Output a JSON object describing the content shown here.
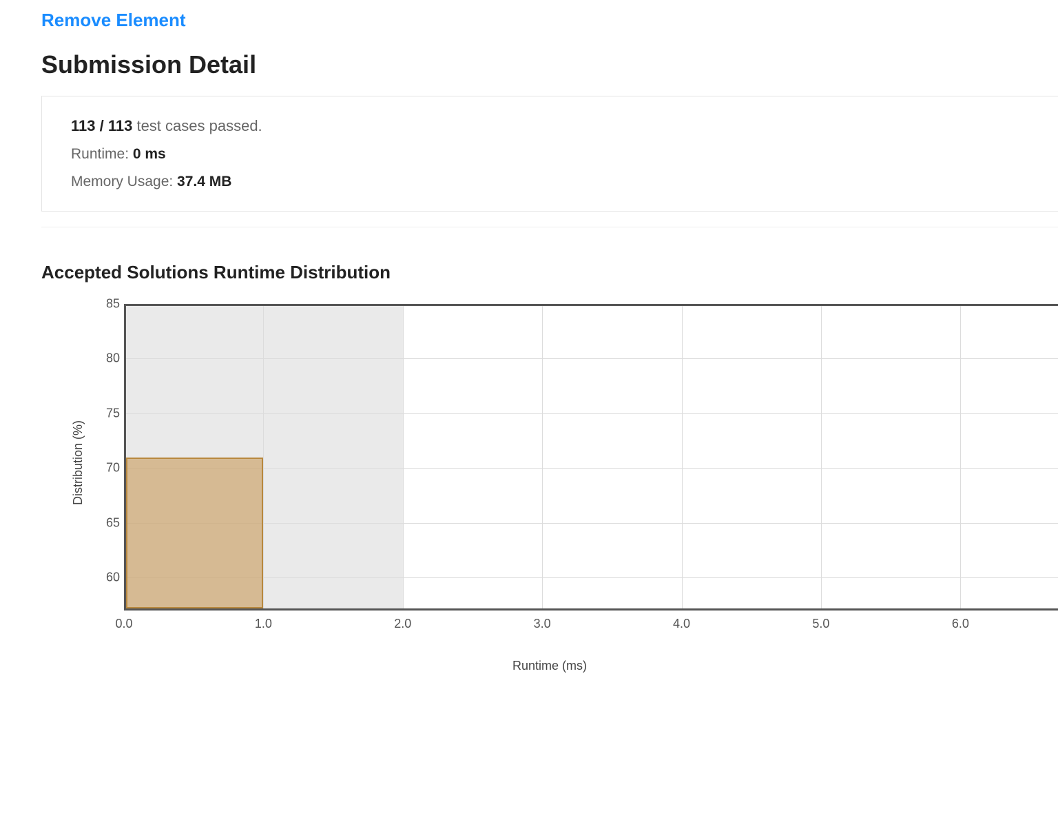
{
  "problem_link": "Remove Element",
  "page_title": "Submission Detail",
  "detail": {
    "cases_passed": "113",
    "cases_total": "113",
    "cases_suffix": " test cases passed.",
    "runtime_label": "Runtime: ",
    "runtime_value": "0 ms",
    "memory_label": "Memory Usage: ",
    "memory_value": "37.4 MB"
  },
  "chart_title": "Accepted Solutions Runtime Distribution",
  "chart_data": {
    "type": "bar",
    "title": "Accepted Solutions Runtime Distribution",
    "xlabel": "Runtime (ms)",
    "ylabel": "Distribution (%)",
    "xlim": [
      0.0,
      6.7
    ],
    "ylim": [
      57,
      85
    ],
    "x_ticks": [
      "0.0",
      "1.0",
      "2.0",
      "3.0",
      "4.0",
      "5.0",
      "6.0"
    ],
    "y_ticks": [
      "60",
      "65",
      "70",
      "75",
      "80",
      "85"
    ],
    "highlight_range": [
      0.0,
      2.0
    ],
    "categories": [
      "0.0"
    ],
    "values": [
      71
    ],
    "bar_width": 1.0
  }
}
